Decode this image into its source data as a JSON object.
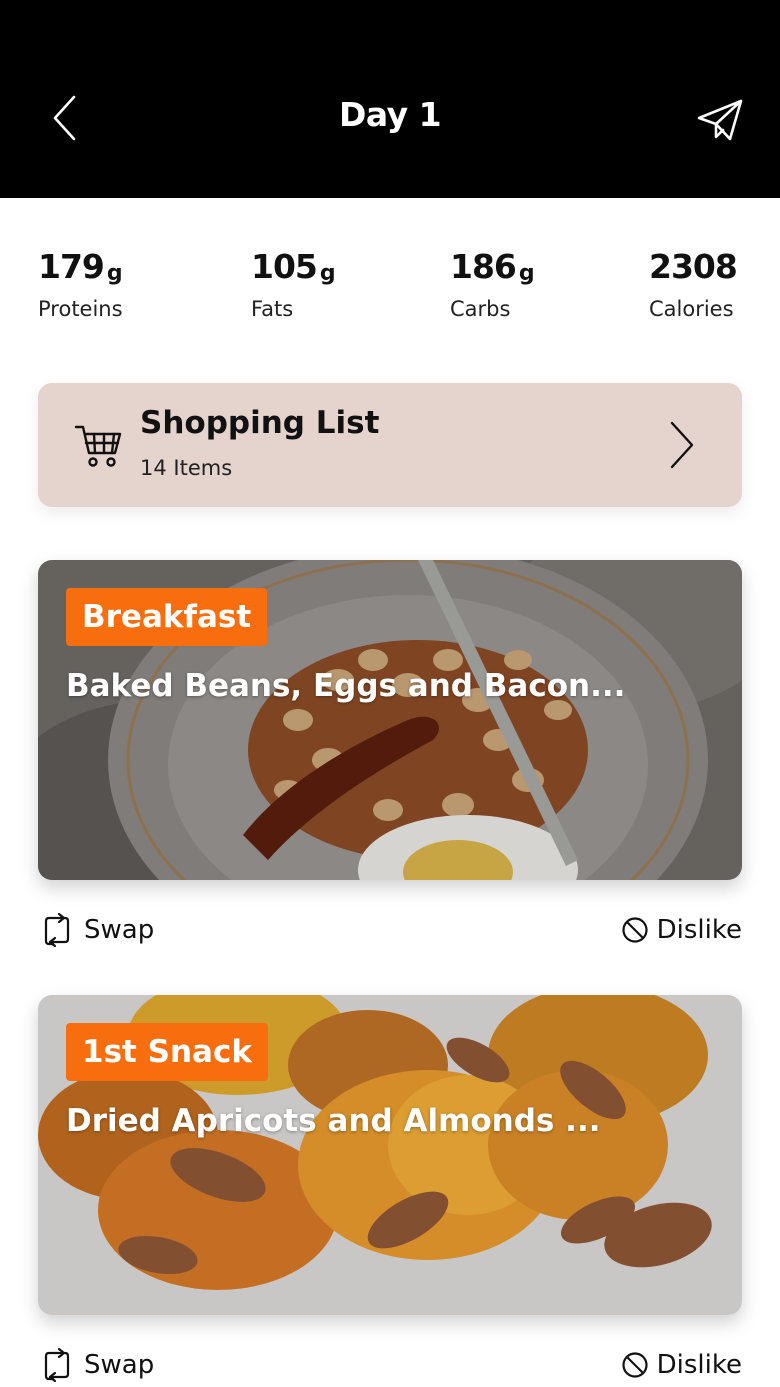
{
  "header": {
    "title": "Day 1",
    "back_icon": "chevron-left-icon",
    "share_icon": "paper-plane-icon"
  },
  "macros": [
    {
      "value": "179",
      "unit": "g",
      "label": "Proteins"
    },
    {
      "value": "105",
      "unit": "g",
      "label": "Fats"
    },
    {
      "value": "186",
      "unit": "g",
      "label": "Carbs"
    },
    {
      "value": "2308",
      "unit": "",
      "label": "Calories"
    }
  ],
  "shopping": {
    "title": "Shopping List",
    "count": "14 Items",
    "icon": "shopping-cart-icon"
  },
  "meals": [
    {
      "badge": "Breakfast",
      "title": "Baked Beans, Eggs and Bacon..."
    },
    {
      "badge": "1st Snack",
      "title": "Dried Apricots and Almonds ..."
    }
  ],
  "actions": {
    "swap_label": "Swap",
    "dislike_label": "Dislike"
  },
  "colors": {
    "header_bg": "#000000",
    "badge": "#f86d0e",
    "shopping_bg": "#e5d3ce"
  }
}
